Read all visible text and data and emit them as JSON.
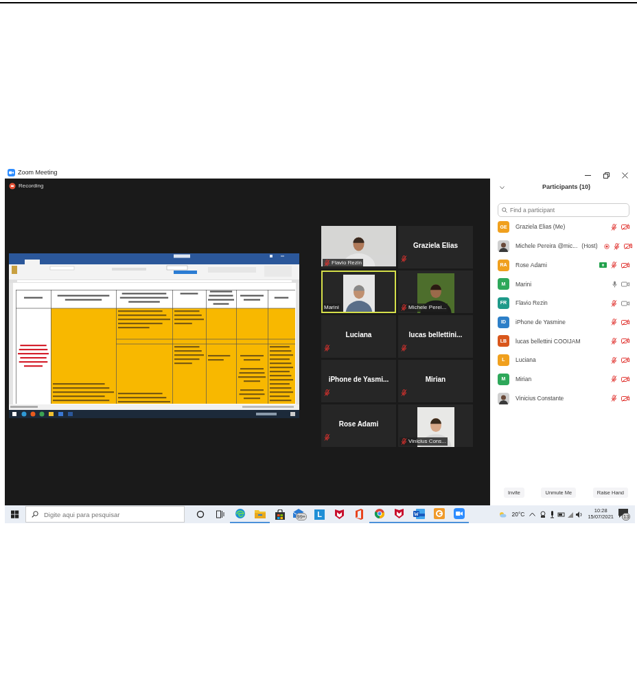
{
  "window": {
    "title": "Zoom Meeting"
  },
  "recording": {
    "label": "Recording"
  },
  "video_tiles": [
    {
      "name": "Flavio Rezin",
      "kind": "video",
      "muted": true,
      "active": false
    },
    {
      "name": "Graziela Elias",
      "kind": "name",
      "muted": true,
      "active": false
    },
    {
      "name": "Marini",
      "kind": "video",
      "muted": false,
      "active": true
    },
    {
      "name": "Michele Perei...",
      "kind": "video",
      "muted": true,
      "active": false
    },
    {
      "name": "Luciana",
      "kind": "name",
      "muted": true,
      "active": false
    },
    {
      "name": "lucas  bellettini...",
      "kind": "name",
      "muted": true,
      "active": false
    },
    {
      "name": "iPhone  de  Yasmi...",
      "kind": "name",
      "muted": true,
      "active": false
    },
    {
      "name": "Mirian",
      "kind": "name",
      "muted": true,
      "active": false
    },
    {
      "name": "Rose Adami",
      "kind": "name",
      "muted": true,
      "active": false
    },
    {
      "name": "Vinicius Cons...",
      "kind": "video",
      "muted": true,
      "active": false
    }
  ],
  "participants_panel": {
    "title": "Participants (10)",
    "search": {
      "placeholder": "Find a participant"
    },
    "participants": [
      {
        "kind": "initials",
        "initials": "GE",
        "color": "#f0a01e",
        "name": "Graziela Elias (Me)",
        "recording": false,
        "sharing": false,
        "muted": true,
        "video_on": false
      },
      {
        "name": "Michele Pereira @mic...",
        "role": "(Host)",
        "recording": true,
        "sharing": false,
        "muted": true,
        "video_on": false
      },
      {
        "kind": "initials",
        "initials": "RA",
        "color": "#f0a01e",
        "name": "Rose Adami",
        "recording": false,
        "sharing": true,
        "muted": true,
        "video_on": false
      },
      {
        "kind": "initials",
        "initials": "M",
        "color": "#2ea85a",
        "name": "Marini",
        "recording": false,
        "sharing": false,
        "muted": false,
        "video_on": true
      },
      {
        "kind": "initials",
        "initials": "FR",
        "color": "#1f9a8a",
        "name": "Flavio Rezin",
        "recording": false,
        "sharing": false,
        "muted": true,
        "video_on": true
      },
      {
        "kind": "initials",
        "initials": "ID",
        "color": "#2d7fc8",
        "name": "iPhone de Yasmine",
        "recording": false,
        "sharing": false,
        "muted": true,
        "video_on": false
      },
      {
        "kind": "initials",
        "initials": "LB",
        "color": "#d9571c",
        "name": "lucas bellettini COOIJAM",
        "recording": false,
        "sharing": false,
        "muted": true,
        "video_on": false
      },
      {
        "kind": "initials",
        "initials": "L",
        "color": "#f0a01e",
        "name": "Luciana",
        "recording": false,
        "sharing": false,
        "muted": true,
        "video_on": false
      },
      {
        "kind": "initials",
        "initials": "M",
        "color": "#2ea85a",
        "name": "Mirian",
        "recording": false,
        "sharing": false,
        "muted": true,
        "video_on": false
      },
      {
        "name": "Vinicius Constante",
        "recording": false,
        "sharing": false,
        "muted": true,
        "video_on": false
      }
    ],
    "buttons": [
      "Invite",
      "Unmute Me",
      "Raise Hand"
    ]
  },
  "taskbar": {
    "search": {
      "placeholder": "Digite aqui para pesquisar"
    },
    "apps": [
      {
        "kind": "cortana",
        "open": false
      },
      {
        "kind": "taskview",
        "open": false
      },
      {
        "kind": "edge",
        "open": true
      },
      {
        "kind": "explorer",
        "open": true
      },
      {
        "kind": "store",
        "open": false
      },
      {
        "kind": "mail",
        "badge": "99+",
        "open": false
      },
      {
        "kind": "letter",
        "letter": "L",
        "open": false
      },
      {
        "kind": "shield",
        "open": false
      },
      {
        "kind": "office",
        "open": false
      },
      {
        "kind": "chrome",
        "open": true
      },
      {
        "kind": "shield",
        "open": true
      },
      {
        "kind": "word",
        "open": true
      },
      {
        "kind": "slides",
        "open": true
      },
      {
        "kind": "zoom",
        "open": true
      }
    ],
    "weather": "20°C",
    "time": "10:28",
    "date": "15/07/2021",
    "notifications": "13"
  }
}
